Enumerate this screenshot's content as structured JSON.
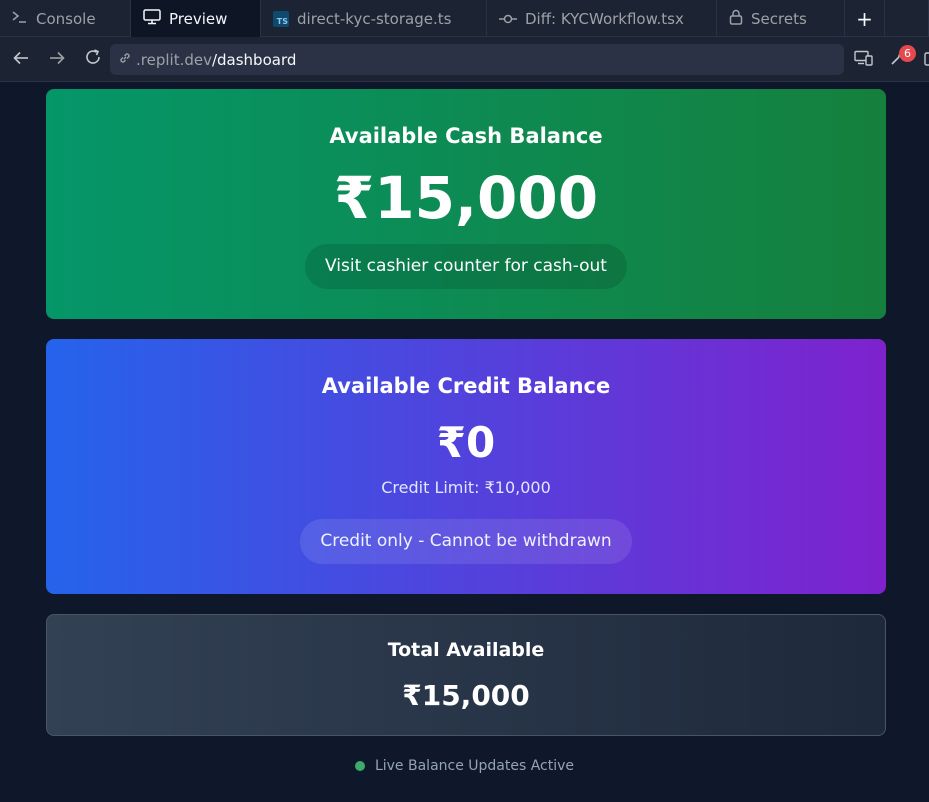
{
  "tabs": [
    {
      "label": "Console",
      "icon": "terminal-icon"
    },
    {
      "label": "Preview",
      "icon": "monitor-icon",
      "active": true
    },
    {
      "label": "direct-kyc-storage.ts",
      "icon": "typescript-file-icon"
    },
    {
      "label": "Diff: KYCWorkflow.tsx",
      "icon": "git-commit-icon"
    },
    {
      "label": "Secrets",
      "icon": "lock-icon"
    }
  ],
  "urlbar": {
    "host": ".replit.dev",
    "path": "/dashboard",
    "devtools_badge": "6"
  },
  "ts_icon_text": "TS",
  "cash": {
    "title": "Available Cash Balance",
    "amount": "₹15,000",
    "note": "Visit cashier counter for cash-out"
  },
  "credit": {
    "title": "Available Credit Balance",
    "amount": "₹0",
    "limit": "Credit Limit: ₹10,000",
    "note": "Credit only - Cannot be withdrawn"
  },
  "total": {
    "title": "Total Available",
    "amount": "₹15,000"
  },
  "status": {
    "text": "Live Balance Updates Active",
    "color": "#4ade80"
  },
  "colors": {
    "cash_gradient": [
      "#059669",
      "#15803d"
    ],
    "credit_gradient": [
      "#2563eb",
      "#7e22ce"
    ],
    "total_gradient": [
      "#334155",
      "#1e293b"
    ],
    "page_bg": "#0f172a"
  }
}
